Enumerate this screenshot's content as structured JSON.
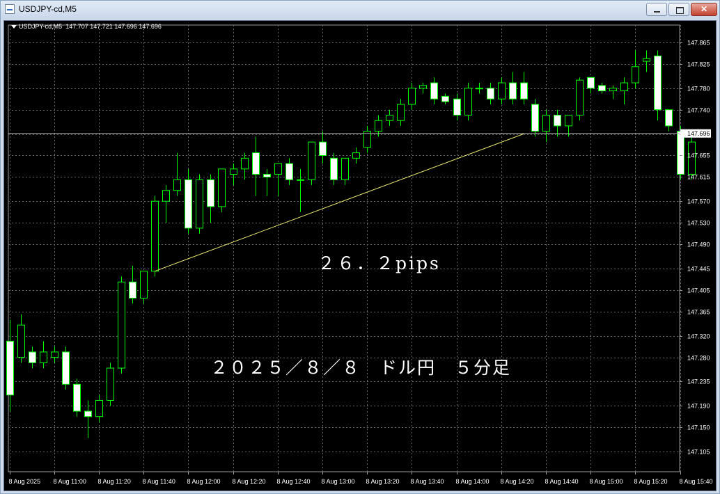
{
  "window": {
    "title": "USDJPY-cd,M5"
  },
  "chart_info": {
    "symbol_tf": "USDJPY-cd,M5",
    "ohlc": "147.707 147.721 147.696 147.696"
  },
  "colors": {
    "background": "#000000",
    "grid": "#6a6a6a",
    "candle_outline": "#00ff00",
    "bull_body": "#000000",
    "bear_body": "#ffffff",
    "bid_line": "#b0b0b0",
    "trend_line": "#e8e870"
  },
  "chart_data": {
    "type": "candlestick",
    "y_axis": {
      "ticks": [
        "147.865",
        "147.825",
        "147.780",
        "147.740",
        "147.695",
        "147.655",
        "147.615",
        "147.570",
        "147.530",
        "147.490",
        "147.445",
        "147.405",
        "147.365",
        "147.320",
        "147.280",
        "147.235",
        "147.190",
        "147.150",
        "147.105"
      ],
      "min": 147.105,
      "max": 147.865,
      "current_price_label": "147.696"
    },
    "x_axis": {
      "labels": [
        "8 Aug 2025",
        "8 Aug 11:00",
        "8 Aug 11:20",
        "8 Aug 11:40",
        "8 Aug 12:00",
        "8 Aug 12:20",
        "8 Aug 12:40",
        "8 Aug 13:00",
        "8 Aug 13:20",
        "8 Aug 13:40",
        "8 Aug 14:00",
        "8 Aug 14:20",
        "8 Aug 14:40",
        "8 Aug 15:00",
        "8 Aug 15:20",
        "8 Aug 15:40"
      ]
    },
    "candles": [
      {
        "o": 147.31,
        "h": 147.35,
        "l": 147.18,
        "c": 147.21
      },
      {
        "o": 147.28,
        "h": 147.36,
        "l": 147.27,
        "c": 147.34
      },
      {
        "o": 147.29,
        "h": 147.3,
        "l": 147.26,
        "c": 147.27
      },
      {
        "o": 147.27,
        "h": 147.31,
        "l": 147.26,
        "c": 147.29
      },
      {
        "o": 147.28,
        "h": 147.3,
        "l": 147.27,
        "c": 147.29
      },
      {
        "o": 147.29,
        "h": 147.3,
        "l": 147.22,
        "c": 147.23
      },
      {
        "o": 147.23,
        "h": 147.24,
        "l": 147.17,
        "c": 147.18
      },
      {
        "o": 147.18,
        "h": 147.2,
        "l": 147.13,
        "c": 147.17
      },
      {
        "o": 147.17,
        "h": 147.21,
        "l": 147.16,
        "c": 147.2
      },
      {
        "o": 147.2,
        "h": 147.27,
        "l": 147.19,
        "c": 147.26
      },
      {
        "o": 147.26,
        "h": 147.43,
        "l": 147.25,
        "c": 147.42
      },
      {
        "o": 147.42,
        "h": 147.45,
        "l": 147.38,
        "c": 147.39
      },
      {
        "o": 147.39,
        "h": 147.44,
        "l": 147.38,
        "c": 147.44
      },
      {
        "o": 147.44,
        "h": 147.58,
        "l": 147.43,
        "c": 147.57
      },
      {
        "o": 147.57,
        "h": 147.6,
        "l": 147.53,
        "c": 147.59
      },
      {
        "o": 147.59,
        "h": 147.66,
        "l": 147.58,
        "c": 147.61
      },
      {
        "o": 147.61,
        "h": 147.63,
        "l": 147.51,
        "c": 147.52
      },
      {
        "o": 147.52,
        "h": 147.62,
        "l": 147.51,
        "c": 147.61
      },
      {
        "o": 147.61,
        "h": 147.62,
        "l": 147.53,
        "c": 147.56
      },
      {
        "o": 147.56,
        "h": 147.63,
        "l": 147.55,
        "c": 147.63
      },
      {
        "o": 147.62,
        "h": 147.64,
        "l": 147.6,
        "c": 147.63
      },
      {
        "o": 147.63,
        "h": 147.66,
        "l": 147.61,
        "c": 147.65
      },
      {
        "o": 147.66,
        "h": 147.69,
        "l": 147.58,
        "c": 147.62
      },
      {
        "o": 147.62,
        "h": 147.63,
        "l": 147.58,
        "c": 147.615
      },
      {
        "o": 147.62,
        "h": 147.64,
        "l": 147.58,
        "c": 147.64
      },
      {
        "o": 147.64,
        "h": 147.65,
        "l": 147.6,
        "c": 147.61
      },
      {
        "o": 147.61,
        "h": 147.63,
        "l": 147.55,
        "c": 147.61
      },
      {
        "o": 147.61,
        "h": 147.67,
        "l": 147.6,
        "c": 147.68
      },
      {
        "o": 147.68,
        "h": 147.7,
        "l": 147.64,
        "c": 147.655
      },
      {
        "o": 147.65,
        "h": 147.66,
        "l": 147.6,
        "c": 147.61
      },
      {
        "o": 147.61,
        "h": 147.65,
        "l": 147.6,
        "c": 147.65
      },
      {
        "o": 147.65,
        "h": 147.67,
        "l": 147.64,
        "c": 147.66
      },
      {
        "o": 147.67,
        "h": 147.71,
        "l": 147.66,
        "c": 147.7
      },
      {
        "o": 147.7,
        "h": 147.73,
        "l": 147.69,
        "c": 147.72
      },
      {
        "o": 147.72,
        "h": 147.74,
        "l": 147.71,
        "c": 147.73
      },
      {
        "o": 147.72,
        "h": 147.76,
        "l": 147.71,
        "c": 147.75
      },
      {
        "o": 147.75,
        "h": 147.79,
        "l": 147.74,
        "c": 147.78
      },
      {
        "o": 147.78,
        "h": 147.79,
        "l": 147.77,
        "c": 147.785
      },
      {
        "o": 147.79,
        "h": 147.8,
        "l": 147.75,
        "c": 147.76
      },
      {
        "o": 147.765,
        "h": 147.77,
        "l": 147.75,
        "c": 147.755
      },
      {
        "o": 147.76,
        "h": 147.77,
        "l": 147.72,
        "c": 147.73
      },
      {
        "o": 147.73,
        "h": 147.79,
        "l": 147.72,
        "c": 147.78
      },
      {
        "o": 147.78,
        "h": 147.79,
        "l": 147.77,
        "c": 147.78
      },
      {
        "o": 147.78,
        "h": 147.79,
        "l": 147.75,
        "c": 147.76
      },
      {
        "o": 147.76,
        "h": 147.8,
        "l": 147.75,
        "c": 147.79
      },
      {
        "o": 147.79,
        "h": 147.81,
        "l": 147.75,
        "c": 147.76
      },
      {
        "o": 147.79,
        "h": 147.81,
        "l": 147.75,
        "c": 147.76
      },
      {
        "o": 147.75,
        "h": 147.76,
        "l": 147.69,
        "c": 147.7
      },
      {
        "o": 147.7,
        "h": 147.74,
        "l": 147.68,
        "c": 147.73
      },
      {
        "o": 147.73,
        "h": 147.74,
        "l": 147.69,
        "c": 147.71
      },
      {
        "o": 147.71,
        "h": 147.73,
        "l": 147.69,
        "c": 147.73
      },
      {
        "o": 147.73,
        "h": 147.8,
        "l": 147.72,
        "c": 147.795
      },
      {
        "o": 147.8,
        "h": 147.8,
        "l": 147.77,
        "c": 147.78
      },
      {
        "o": 147.785,
        "h": 147.79,
        "l": 147.77,
        "c": 147.775
      },
      {
        "o": 147.775,
        "h": 147.785,
        "l": 147.76,
        "c": 147.78
      },
      {
        "o": 147.775,
        "h": 147.8,
        "l": 147.75,
        "c": 147.79
      },
      {
        "o": 147.79,
        "h": 147.85,
        "l": 147.78,
        "c": 147.82
      },
      {
        "o": 147.83,
        "h": 147.85,
        "l": 147.81,
        "c": 147.835
      },
      {
        "o": 147.84,
        "h": 147.85,
        "l": 147.72,
        "c": 147.74
      },
      {
        "o": 147.74,
        "h": 147.74,
        "l": 147.7,
        "c": 147.71
      },
      {
        "o": 147.7,
        "h": 147.71,
        "l": 147.61,
        "c": 147.62
      },
      {
        "o": 147.62,
        "h": 147.7,
        "l": 147.61,
        "c": 147.68
      }
    ],
    "trend_line": {
      "from_index": 13,
      "from_price": 147.44,
      "to_index": 46,
      "to_price": 147.695
    },
    "annotations": {
      "pips": "２６．２pips",
      "date_title": "２０２５／８／８　ドル円　５分足"
    }
  }
}
